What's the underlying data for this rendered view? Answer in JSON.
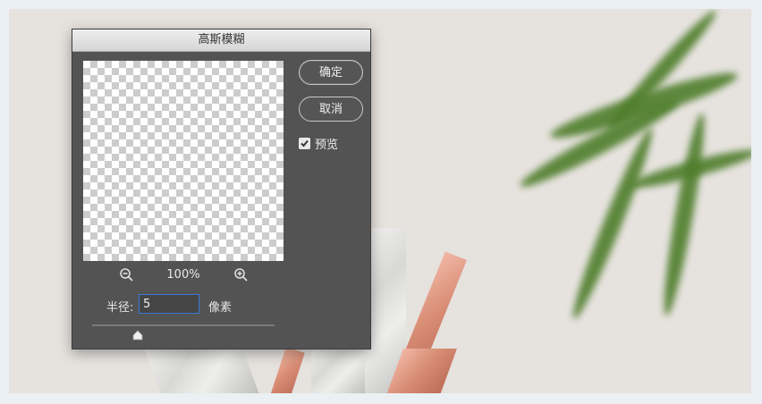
{
  "dialog": {
    "title": "高斯模糊",
    "ok_label": "确定",
    "cancel_label": "取消",
    "preview_label": "预览",
    "preview_checked": true,
    "zoom_level": "100%",
    "radius_label": "半径:",
    "radius_value": "5",
    "radius_unit": "像素",
    "slider_level": 0.25
  },
  "colors": {
    "dialog_bg": "#535353",
    "focus_border": "#3b78d8"
  },
  "icons": {
    "zoom_out": "zoom-out-icon",
    "zoom_in": "zoom-in-icon",
    "checkbox": "checkmark-icon",
    "slider": "slider-thumb-icon"
  }
}
